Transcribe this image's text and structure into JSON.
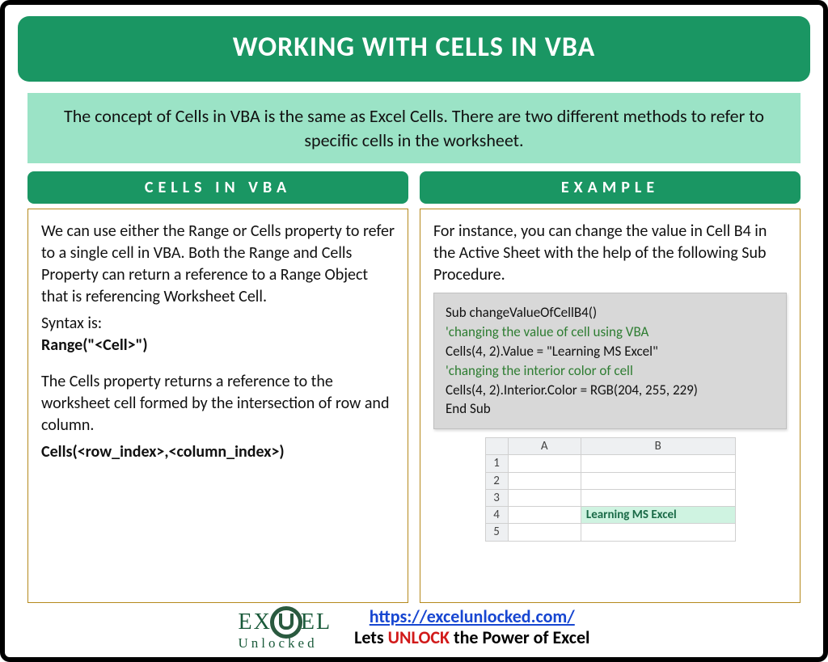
{
  "title": "WORKING WITH CELLS IN VBA",
  "intro": "The concept of Cells in VBA is the same as Excel Cells. There are two different methods to refer to specific cells in the worksheet.",
  "left": {
    "heading": "CELLS IN VBA",
    "p1": "We can use either the Range or Cells property to refer to a single cell in VBA. Both the Range and Cells Property can return a reference to a Range Object that is referencing Worksheet Cell.",
    "syntax_label": "Syntax is:",
    "syntax_code": "Range(\"<Cell>\")",
    "p2": "The Cells property returns a reference to the worksheet cell formed by the intersection of row and column.",
    "cells_code": "Cells(<row_index>,<column_index>)"
  },
  "right": {
    "heading": "EXAMPLE",
    "p1": "For instance, you can change the value in Cell B4 in the Active Sheet with the help of the following Sub Procedure.",
    "code": {
      "l1": "Sub changeValueOfCellB4()",
      "l2": "'changing the value of cell using VBA",
      "l3": "Cells(4, 2).Value = \"Learning MS Excel\"",
      "l4": "'changing the interior color of cell",
      "l5": "Cells(4, 2).Interior.Color = RGB(204, 255, 229)",
      "l6": "End Sub"
    },
    "sheet": {
      "colA": "A",
      "colB": "B",
      "rows": [
        "1",
        "2",
        "3",
        "4",
        "5"
      ],
      "b4": "Learning MS Excel"
    }
  },
  "footer": {
    "url": "https://excelunlocked.com/",
    "tag_pre": "Lets ",
    "tag_word": "UNLOCK",
    "tag_post": " the Power of Excel",
    "logo_top_left": "EX",
    "logo_top_right": "EL",
    "logo_bottom": "Unlocked"
  }
}
